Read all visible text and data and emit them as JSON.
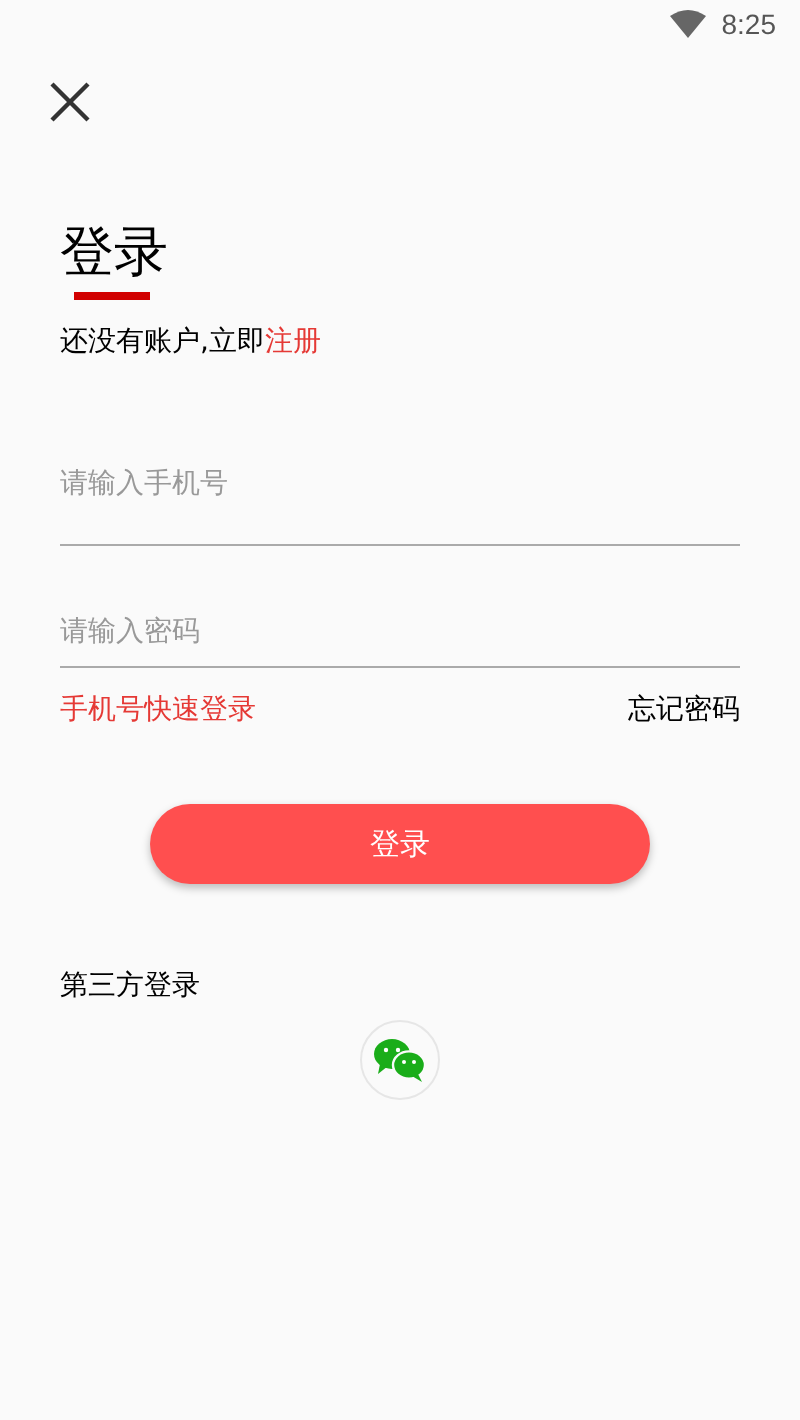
{
  "status_bar": {
    "time": "8:25"
  },
  "title": "登录",
  "register_prompt": {
    "text": "还没有账户,立即",
    "link": "注册"
  },
  "fields": [
    {
      "placeholder": "请输入手机号"
    },
    {
      "placeholder": "请输入密码"
    }
  ],
  "quick_login_link": "手机号快速登录",
  "forgot_password_link": "忘记密码",
  "login_button": "登录",
  "third_party": {
    "label": "第三方登录"
  }
}
